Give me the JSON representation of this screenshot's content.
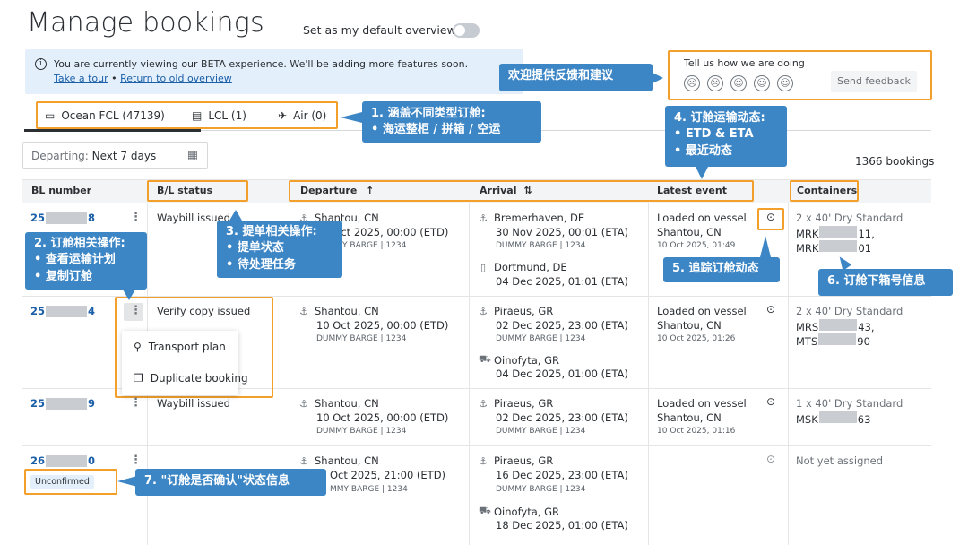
{
  "page": {
    "title": "Manage bookings",
    "default_overview_label": "Set as my default overview"
  },
  "beta": {
    "message": "You are currently viewing our BETA experience. We'll be adding more features soon.",
    "link_tour": "Take a tour",
    "separator": " • ",
    "link_old": "Return to old overview"
  },
  "feedback": {
    "label": "Tell us how we are doing",
    "button": "Send feedback",
    "faces": [
      "☹",
      "☹",
      "☺",
      "☺",
      "☺"
    ]
  },
  "tabs": [
    {
      "label": "Ocean FCL (47139)",
      "icon": "container-icon"
    },
    {
      "label": "LCL (1)",
      "icon": "boxes-icon"
    },
    {
      "label": "Air (0)",
      "icon": "plane-icon"
    }
  ],
  "filter": {
    "prefix": "Departing: ",
    "value": "Next 7 days"
  },
  "bookings_count": "1366 bookings",
  "columns": {
    "bl_number": "BL number",
    "bl_status": "B/L status",
    "departure": "Departure",
    "arrival": "Arrival",
    "latest_event": "Latest event",
    "containers": "Containers"
  },
  "rows": [
    {
      "bl_prefix": "25",
      "bl_suffix": "8",
      "status": "Waybill issued",
      "dep_port": "Shantou, CN",
      "dep_time": "10 Oct 2025, 00:00 (ETD)",
      "dep_vessel": "DUMMY BARGE | 1234",
      "arr_port": "Bremerhaven, DE",
      "arr_time": "30 Nov 2025, 00:01 (ETA)",
      "arr_vessel": "DUMMY BARGE | 1234",
      "arr2_port": "Dortmund, DE",
      "arr2_time": "04 Dec 2025, 01:01 (ETA)",
      "event": "Loaded on vessel",
      "event_place": "Shantou, CN",
      "event_time": "10 Oct 2025, 01:49",
      "containers": "2 x 40' Dry Standard",
      "c1_prefix": "MRK",
      "c1_suffix": "11,",
      "c2_prefix": "MRK",
      "c2_suffix": "01"
    },
    {
      "bl_prefix": "25",
      "bl_suffix": "4",
      "status": "Verify copy issued",
      "dep_port": "Shantou, CN",
      "dep_time": "10 Oct 2025, 00:00 (ETD)",
      "dep_vessel": "DUMMY BARGE | 1234",
      "arr_port": "Piraeus, GR",
      "arr_time": "02 Dec 2025, 23:00 (ETA)",
      "arr_vessel": "DUMMY BARGE | 1234",
      "arr2_port": "Oinofyta, GR",
      "arr2_time": "04 Dec 2025, 01:00 (ETA)",
      "event": "Loaded on vessel",
      "event_place": "Shantou, CN",
      "event_time": "10 Oct 2025, 01:26",
      "containers": "2 x 40' Dry Standard",
      "c1_prefix": "MRS",
      "c1_suffix": "43,",
      "c2_prefix": "MTS",
      "c2_suffix": "90"
    },
    {
      "bl_prefix": "25",
      "bl_suffix": "9",
      "status": "Waybill issued",
      "dep_port": "Shantou, CN",
      "dep_time": "10 Oct 2025, 00:00 (ETD)",
      "dep_vessel": "DUMMY BARGE | 1234",
      "arr_port": "Piraeus, GR",
      "arr_time": "02 Dec 2025, 23:00 (ETA)",
      "arr_vessel": "DUMMY BARGE | 1234",
      "event": "Loaded on vessel",
      "event_place": "Shantou, CN",
      "event_time": "10 Oct 2025, 01:16",
      "containers": "1 x 40' Dry Standard",
      "c1_prefix": "MSK",
      "c1_suffix": "63"
    },
    {
      "bl_prefix": "26",
      "bl_suffix": "0",
      "badge": "Unconfirmed",
      "dep_port": "Shantou, CN",
      "dep_time": "Oct 2025, 21:00 (ETD)",
      "dep_vessel": "MMY BARGE | 1234",
      "arr_port": "Piraeus, GR",
      "arr_time": "16 Dec 2025, 23:00 (ETA)",
      "arr_vessel": "DUMMY BARGE | 1234",
      "arr2_port": "Oinofyta, GR",
      "arr2_time": "18 Dec 2025, 01:00 (ETA)",
      "containers": "Not yet assigned"
    }
  ],
  "menu": {
    "transport_plan": "Transport plan",
    "duplicate": "Duplicate booking"
  },
  "callouts": {
    "feedback": "欢迎提供反馈和建议",
    "c1_title": "1. 涵盖不同类型订舱:",
    "c1_line": "• 海运整柜 / 拼箱 / 空运",
    "c2_title": "2. 订舱相关操作:",
    "c2_l1": "• 查看运输计划",
    "c2_l2": "• 复制订舱",
    "c3_title": "3. 提单相关操作:",
    "c3_l1": "• 提单状态",
    "c3_l2": "• 待处理任务",
    "c4_title": "4. 订舱运输动态:",
    "c4_l1": "• ETD & ETA",
    "c4_l2": "• 最近动态",
    "c5": "5. 追踪订舱动态",
    "c6": "6. 订舱下箱号信息",
    "c7": "7. \"订舱是否确认\"状态信息"
  }
}
